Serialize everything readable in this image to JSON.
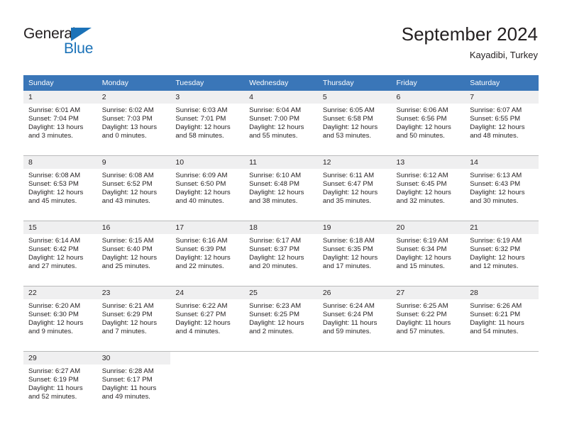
{
  "logo": {
    "text_primary": "General",
    "text_secondary": "Blue",
    "primary_color": "#231f20",
    "accent_color": "#1b72b8"
  },
  "header": {
    "title": "September 2024",
    "subtitle": "Kayadibi, Turkey"
  },
  "calendar": {
    "header_bg": "#3a76b8",
    "daynum_bg": "#efeff0",
    "weekday_headers": [
      "Sunday",
      "Monday",
      "Tuesday",
      "Wednesday",
      "Thursday",
      "Friday",
      "Saturday"
    ],
    "weeks": [
      [
        {
          "day": "1",
          "lines": [
            "Sunrise: 6:01 AM",
            "Sunset: 7:04 PM",
            "Daylight: 13 hours",
            "and 3 minutes."
          ]
        },
        {
          "day": "2",
          "lines": [
            "Sunrise: 6:02 AM",
            "Sunset: 7:03 PM",
            "Daylight: 13 hours",
            "and 0 minutes."
          ]
        },
        {
          "day": "3",
          "lines": [
            "Sunrise: 6:03 AM",
            "Sunset: 7:01 PM",
            "Daylight: 12 hours",
            "and 58 minutes."
          ]
        },
        {
          "day": "4",
          "lines": [
            "Sunrise: 6:04 AM",
            "Sunset: 7:00 PM",
            "Daylight: 12 hours",
            "and 55 minutes."
          ]
        },
        {
          "day": "5",
          "lines": [
            "Sunrise: 6:05 AM",
            "Sunset: 6:58 PM",
            "Daylight: 12 hours",
            "and 53 minutes."
          ]
        },
        {
          "day": "6",
          "lines": [
            "Sunrise: 6:06 AM",
            "Sunset: 6:56 PM",
            "Daylight: 12 hours",
            "and 50 minutes."
          ]
        },
        {
          "day": "7",
          "lines": [
            "Sunrise: 6:07 AM",
            "Sunset: 6:55 PM",
            "Daylight: 12 hours",
            "and 48 minutes."
          ]
        }
      ],
      [
        {
          "day": "8",
          "lines": [
            "Sunrise: 6:08 AM",
            "Sunset: 6:53 PM",
            "Daylight: 12 hours",
            "and 45 minutes."
          ]
        },
        {
          "day": "9",
          "lines": [
            "Sunrise: 6:08 AM",
            "Sunset: 6:52 PM",
            "Daylight: 12 hours",
            "and 43 minutes."
          ]
        },
        {
          "day": "10",
          "lines": [
            "Sunrise: 6:09 AM",
            "Sunset: 6:50 PM",
            "Daylight: 12 hours",
            "and 40 minutes."
          ]
        },
        {
          "day": "11",
          "lines": [
            "Sunrise: 6:10 AM",
            "Sunset: 6:48 PM",
            "Daylight: 12 hours",
            "and 38 minutes."
          ]
        },
        {
          "day": "12",
          "lines": [
            "Sunrise: 6:11 AM",
            "Sunset: 6:47 PM",
            "Daylight: 12 hours",
            "and 35 minutes."
          ]
        },
        {
          "day": "13",
          "lines": [
            "Sunrise: 6:12 AM",
            "Sunset: 6:45 PM",
            "Daylight: 12 hours",
            "and 32 minutes."
          ]
        },
        {
          "day": "14",
          "lines": [
            "Sunrise: 6:13 AM",
            "Sunset: 6:43 PM",
            "Daylight: 12 hours",
            "and 30 minutes."
          ]
        }
      ],
      [
        {
          "day": "15",
          "lines": [
            "Sunrise: 6:14 AM",
            "Sunset: 6:42 PM",
            "Daylight: 12 hours",
            "and 27 minutes."
          ]
        },
        {
          "day": "16",
          "lines": [
            "Sunrise: 6:15 AM",
            "Sunset: 6:40 PM",
            "Daylight: 12 hours",
            "and 25 minutes."
          ]
        },
        {
          "day": "17",
          "lines": [
            "Sunrise: 6:16 AM",
            "Sunset: 6:39 PM",
            "Daylight: 12 hours",
            "and 22 minutes."
          ]
        },
        {
          "day": "18",
          "lines": [
            "Sunrise: 6:17 AM",
            "Sunset: 6:37 PM",
            "Daylight: 12 hours",
            "and 20 minutes."
          ]
        },
        {
          "day": "19",
          "lines": [
            "Sunrise: 6:18 AM",
            "Sunset: 6:35 PM",
            "Daylight: 12 hours",
            "and 17 minutes."
          ]
        },
        {
          "day": "20",
          "lines": [
            "Sunrise: 6:19 AM",
            "Sunset: 6:34 PM",
            "Daylight: 12 hours",
            "and 15 minutes."
          ]
        },
        {
          "day": "21",
          "lines": [
            "Sunrise: 6:19 AM",
            "Sunset: 6:32 PM",
            "Daylight: 12 hours",
            "and 12 minutes."
          ]
        }
      ],
      [
        {
          "day": "22",
          "lines": [
            "Sunrise: 6:20 AM",
            "Sunset: 6:30 PM",
            "Daylight: 12 hours",
            "and 9 minutes."
          ]
        },
        {
          "day": "23",
          "lines": [
            "Sunrise: 6:21 AM",
            "Sunset: 6:29 PM",
            "Daylight: 12 hours",
            "and 7 minutes."
          ]
        },
        {
          "day": "24",
          "lines": [
            "Sunrise: 6:22 AM",
            "Sunset: 6:27 PM",
            "Daylight: 12 hours",
            "and 4 minutes."
          ]
        },
        {
          "day": "25",
          "lines": [
            "Sunrise: 6:23 AM",
            "Sunset: 6:25 PM",
            "Daylight: 12 hours",
            "and 2 minutes."
          ]
        },
        {
          "day": "26",
          "lines": [
            "Sunrise: 6:24 AM",
            "Sunset: 6:24 PM",
            "Daylight: 11 hours",
            "and 59 minutes."
          ]
        },
        {
          "day": "27",
          "lines": [
            "Sunrise: 6:25 AM",
            "Sunset: 6:22 PM",
            "Daylight: 11 hours",
            "and 57 minutes."
          ]
        },
        {
          "day": "28",
          "lines": [
            "Sunrise: 6:26 AM",
            "Sunset: 6:21 PM",
            "Daylight: 11 hours",
            "and 54 minutes."
          ]
        }
      ],
      [
        {
          "day": "29",
          "lines": [
            "Sunrise: 6:27 AM",
            "Sunset: 6:19 PM",
            "Daylight: 11 hours",
            "and 52 minutes."
          ]
        },
        {
          "day": "30",
          "lines": [
            "Sunrise: 6:28 AM",
            "Sunset: 6:17 PM",
            "Daylight: 11 hours",
            "and 49 minutes."
          ]
        },
        null,
        null,
        null,
        null,
        null
      ]
    ]
  }
}
